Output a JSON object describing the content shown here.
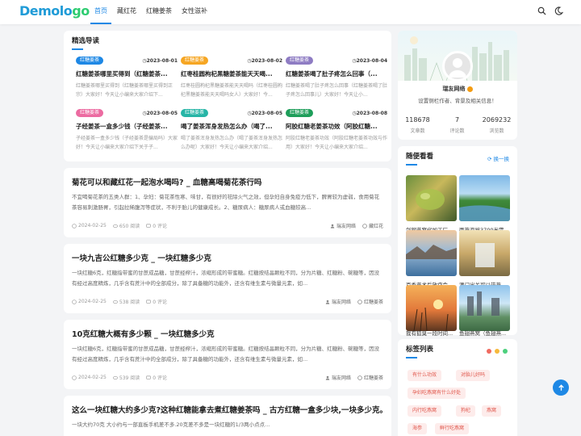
{
  "brand": {
    "logo_main": "Demolo",
    "logo_tail": "go"
  },
  "nav": [
    "首页",
    "藏红花",
    "红糖姜茶",
    "女性滋补"
  ],
  "featured": {
    "title": "精选导读",
    "items": [
      {
        "tag": "红糖姜茶",
        "date": "2023-08-01",
        "title": "红糖姜茶哪里买得到（红糖姜茶...",
        "desc": "红糖姜茶哪里买得到（红糖姜茶哪里买得到正宗）大家好！今天让小编来大家介绍下..."
      },
      {
        "tag": "红糖姜茶",
        "date": "2023-08-02",
        "title": "红枣桂圆枸杞黑糖姜茶能天天喝...",
        "desc": "红枣桂圆枸杞黑糖姜茶能天天喝吗（红枣桂圆枸杞黑糖姜茶能天天喝吗女人）大家好！今..."
      },
      {
        "tag": "红糖姜茶",
        "date": "2023-08-04",
        "title": "红糖姜茶喝了肚子疼怎么回事（...",
        "desc": "红糖姜茶喝了肚子疼怎么回事（红糖姜茶喝了肚子疼怎么回事儿）大家好！今天让小..."
      },
      {
        "tag": "红糖姜茶",
        "date": "2023-08-05",
        "title": "子经姜茶一盒多少钱（子经姜茶...",
        "desc": "子经姜茶一盒多少钱（子经姜茶是骗局吗）大家好！今天让小编来大家介绍下关于子..."
      },
      {
        "tag": "红糖姜茶",
        "date": "2023-08-05",
        "title": "喝了姜茶浑身发热怎么办（喝了...",
        "desc": "喝了姜茶浑身发热怎么办（喝了姜茶浑身发热怎么办呢）大家好！今天让小编来大家介绍..."
      },
      {
        "tag": "红糖姜茶",
        "date": "2023-08-08",
        "title": "阿胶红糖老姜茶功效（阿胶红糖...",
        "desc": "阿胶红糖老姜茶功效（阿胶红糖老姜茶功效与作用）大家好！今天让小编来大家介绍..."
      }
    ]
  },
  "posts": [
    {
      "title": "菊花可以和藏红花一起泡水喝吗? _ 血糖高喝菊花茶行吗",
      "desc": "不宜喝菊花茶的五类人群：1、孕妇：菊花茶性寒、味甘，有很好的祛除火气之效，但孕妇自身免疫力低下，脾胃较为虚弱，食用菊花茶容易刺激肠胃，引起拉稀腹泻等症状，不利于胎儿的健康成长。2、糖尿病人：糖尿病人或血糖较高...",
      "date": "2024-02-25",
      "views": "650 阅读",
      "comments": "0 评论",
      "author": "瑞友网络",
      "category": "藏红花"
    },
    {
      "title": "一块九吉公红糖多少克 _ 一块红糖多少克",
      "desc": "一块红糖6克，红糖指带蜜的甘蔗成品糖，甘蔗经榨汁，浓缩形成的带蜜糖。红糖按结晶颗粒不同，分为片糖、红糖粉、碗糖等，因没有经过高度精炼，几乎含有蔗汁中的全部成分，除了具备糖的功能外，还含有维生素与微量元素，如...",
      "date": "2024-02-25",
      "views": "538 阅读",
      "comments": "0 评论",
      "author": "瑞友网络",
      "category": "红糖姜茶"
    },
    {
      "title": "10克红糖大概有多少颗 _ 一块红糖多少克",
      "desc": "一块红糖6克，红糖指带蜜的甘蔗成品糖，甘蔗经榨汁，浓缩形成的带蜜糖。红糖按结晶颗粒不同，分为片糖、红糖粉、碗糖等，因没有经过高度精炼，几乎含有蔗汁中的全部成分，除了具备糖的功能外，还含有维生素与微量元素，如...",
      "date": "2024-02-25",
      "views": "539 阅读",
      "comments": "0 评论",
      "author": "瑞友网络",
      "category": "红糖姜茶"
    },
    {
      "title": "这么一块红糖大约多少克?这种红糖能拿去煮红糖姜茶吗 _ 古方红糖一盒多少块,一块多少克。",
      "desc": "一块大约70克 大小约与一部直板手机差不多.20克差不多是一块红糖的1/3两小点点..."
    }
  ],
  "profile": {
    "name": "瑞友网络",
    "subtitle": "设置侧栏作者、背景及相关信息！",
    "stats": [
      {
        "n": "118678",
        "l": "文章数"
      },
      {
        "n": "7",
        "l": "评论数"
      },
      {
        "n": "2069232",
        "l": "浏览数"
      }
    ]
  },
  "random": {
    "title": "随便看看",
    "swap": "换一换",
    "items": [
      "剑网燕窝代加工厂...",
      "雨燕海拔3700米需...",
      "百香燕术后放疗会...",
      "澳门出关可以带燕...",
      "我有狐臭一段时间...",
      "鱼翅燕窝（鱼翅燕..."
    ]
  },
  "tags": {
    "title": "标签列表",
    "items": [
      "有什么功效",
      "对胎儿好吗",
      "孕妇吃燕窝有什么好处",
      "内行吃燕窝",
      "狗杞",
      "燕窝",
      "海参",
      "鲜行吃燕窝"
    ]
  }
}
